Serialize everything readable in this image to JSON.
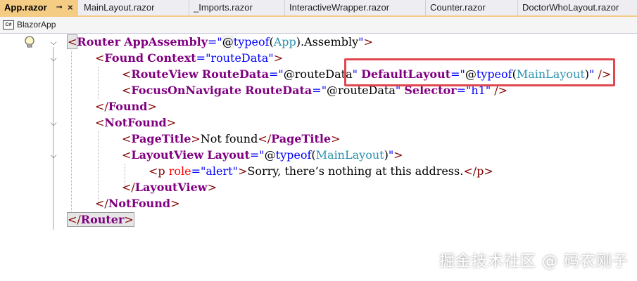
{
  "tabs": [
    {
      "label": "App.razor",
      "active": true
    },
    {
      "label": "MainLayout.razor"
    },
    {
      "label": "_Imports.razor"
    },
    {
      "label": "InteractiveWrapper.razor"
    },
    {
      "label": "Counter.razor"
    },
    {
      "label": "DoctorWhoLayout.razor"
    }
  ],
  "tab_pin_glyph": "⊸",
  "tab_close_glyph": "×",
  "navbar": {
    "project": "BlazorApp",
    "project_icon": "C#"
  },
  "code": {
    "l1": {
      "lt": "<",
      "name": "Router",
      "attr": "AppAssembly",
      "eq": "=\"",
      "razor": "@",
      "kw": "typeof",
      "open": "(",
      "cls": "App",
      "rest": ").Assembly",
      "close_q": "\"",
      "gt": ">"
    },
    "l2": {
      "lt": "<",
      "name": "Found",
      "attr": "Context",
      "eq": "=\"",
      "val": "routeData",
      "close_q": "\"",
      "gt": ">"
    },
    "l3": {
      "lt": "<",
      "name": "RouteView",
      "attr1": "RouteData",
      "eq": "=\"",
      "razor1": "@routeData",
      "close_q": "\"",
      "attr2": "DefaultLayout",
      "razor2": "@",
      "kw": "typeof",
      "open": "(",
      "cls": "MainLayout",
      "close": ")",
      "end": " />"
    },
    "l4": {
      "lt": "<",
      "name": "FocusOnNavigate",
      "attr1": "RouteData",
      "eq": "=\"",
      "razor1": "@routeData",
      "close_q": "\"",
      "attr2": "Selector",
      "val2": "h1",
      "end": " />"
    },
    "l5": {
      "text": "</",
      "name": "Found",
      "gt": ">"
    },
    "l6": {
      "lt": "<",
      "name": "NotFound",
      "gt": ">"
    },
    "l7": {
      "lt": "<",
      "name": "PageTitle",
      "gt": ">",
      "text": "Not found",
      "lt2": "</",
      "name2": "PageTitle",
      "gt2": ">"
    },
    "l8": {
      "lt": "<",
      "name": "LayoutView",
      "attr": "Layout",
      "eq": "=\"",
      "razor": "@",
      "kw": "typeof",
      "open": "(",
      "cls": "MainLayout",
      "close": ")",
      "close_q": "\"",
      "gt": ">"
    },
    "l9": {
      "lt": "<",
      "name": "p",
      "attr": "role",
      "eq": "=\"",
      "val": "alert",
      "close_q": "\"",
      "gt": ">",
      "text": "Sorry, there’s nothing at this address.",
      "lt2": "</",
      "name2": "p",
      "gt2": ">"
    },
    "l10": {
      "text": "</",
      "name": "LayoutView",
      "gt": ">"
    },
    "l11": {
      "text": "</",
      "name": "NotFound",
      "gt": ">"
    },
    "l12": {
      "text": "</",
      "name": "Router",
      "gt": ">"
    }
  },
  "fold_glyph": "⌵",
  "watermark": "掘金技术社区 @ 码农刚子",
  "colors": {
    "active_tab": "#f5cc84",
    "highlight_box": "#e1474f",
    "tag": "#800000",
    "attr": "#800080",
    "value": "#0000ff",
    "type": "#2b91af"
  }
}
